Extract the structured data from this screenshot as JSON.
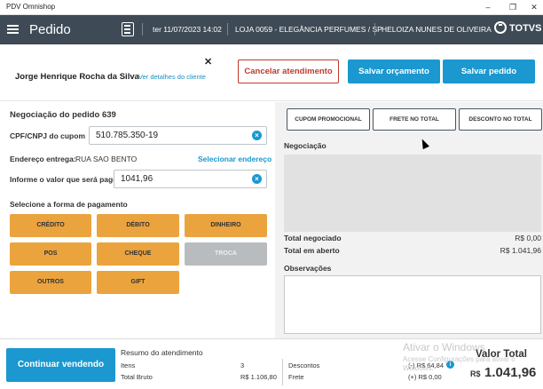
{
  "window": {
    "title": "PDV Omnishop",
    "minimize": "–",
    "maximize": "❐",
    "close": "✕"
  },
  "header": {
    "page_title": "Pedido",
    "date": "ter 11/07/2023 14:02",
    "store": "LOJA 0059 - ELEGÂNCIA PERFUMES / SP",
    "user": "HELOIZA NUNES DE OLIVEIRA",
    "brand": "TOTVS"
  },
  "customer": {
    "name": "Jorge Henrique Rocha da Silva",
    "details_link": "Ver detalhes do cliente",
    "close": "✕"
  },
  "actions": {
    "cancel": "Cancelar atendimento",
    "save_quote": "Salvar orçamento",
    "save_order": "Salvar pedido"
  },
  "negotiation": {
    "title": "Negociação do pedido 639",
    "coupon_label": "CPF/CNPJ do cupom",
    "coupon_value": "510.785.350-19",
    "address_label": "Endereço entrega:",
    "address_value": "RUA SAO BENTO",
    "address_link": "Selecionar endereço",
    "amount_label": "Informe o valor que será pago",
    "amount_value": "1041,96",
    "payment_title": "Selecione a forma de pagamento",
    "payment_methods": [
      {
        "label": "CRÉDITO",
        "enabled": true
      },
      {
        "label": "DÉBITO",
        "enabled": true
      },
      {
        "label": "DINHEIRO",
        "enabled": true
      },
      {
        "label": "POS",
        "enabled": true
      },
      {
        "label": "CHEQUE",
        "enabled": true
      },
      {
        "label": "TROCA",
        "enabled": false
      },
      {
        "label": "OUTROS",
        "enabled": true
      },
      {
        "label": "GIFT",
        "enabled": true
      }
    ]
  },
  "right": {
    "tabs": [
      "CUPOM PROMOCIONAL",
      "FRETE NO TOTAL",
      "DESCONTO NO TOTAL"
    ],
    "negotiation_label": "Negociação",
    "total_negotiated_label": "Total negociado",
    "total_negotiated_value": "R$ 0,00",
    "total_open_label": "Total em aberto",
    "total_open_value": "R$ 1.041,96",
    "observations_label": "Observações"
  },
  "footer": {
    "continue": "Continuar vendendo",
    "summary_title": "Resumo do atendimento",
    "items_label": "Itens",
    "items_value": "3",
    "gross_label": "Total Bruto",
    "gross_value": "R$ 1.106,80",
    "discounts_label": "Descontos",
    "discounts_value": "(-) R$ 64,84",
    "freight_label": "Frete",
    "freight_value": "(+) R$ 0,00",
    "total_label": "Valor Total",
    "total_currency": "R$",
    "total_value": "1.041,96",
    "watermark_title": "Ativar o Windows",
    "watermark_line1": "Acesse Configurações para ativar o",
    "watermark_line2": "Windows."
  },
  "colors": {
    "header_bg": "#3e4a55",
    "accent_blue": "#1a98cf",
    "cancel_red": "#c0392b",
    "payment_orange": "#eba33e",
    "disabled_grey": "#b8bcbf"
  }
}
